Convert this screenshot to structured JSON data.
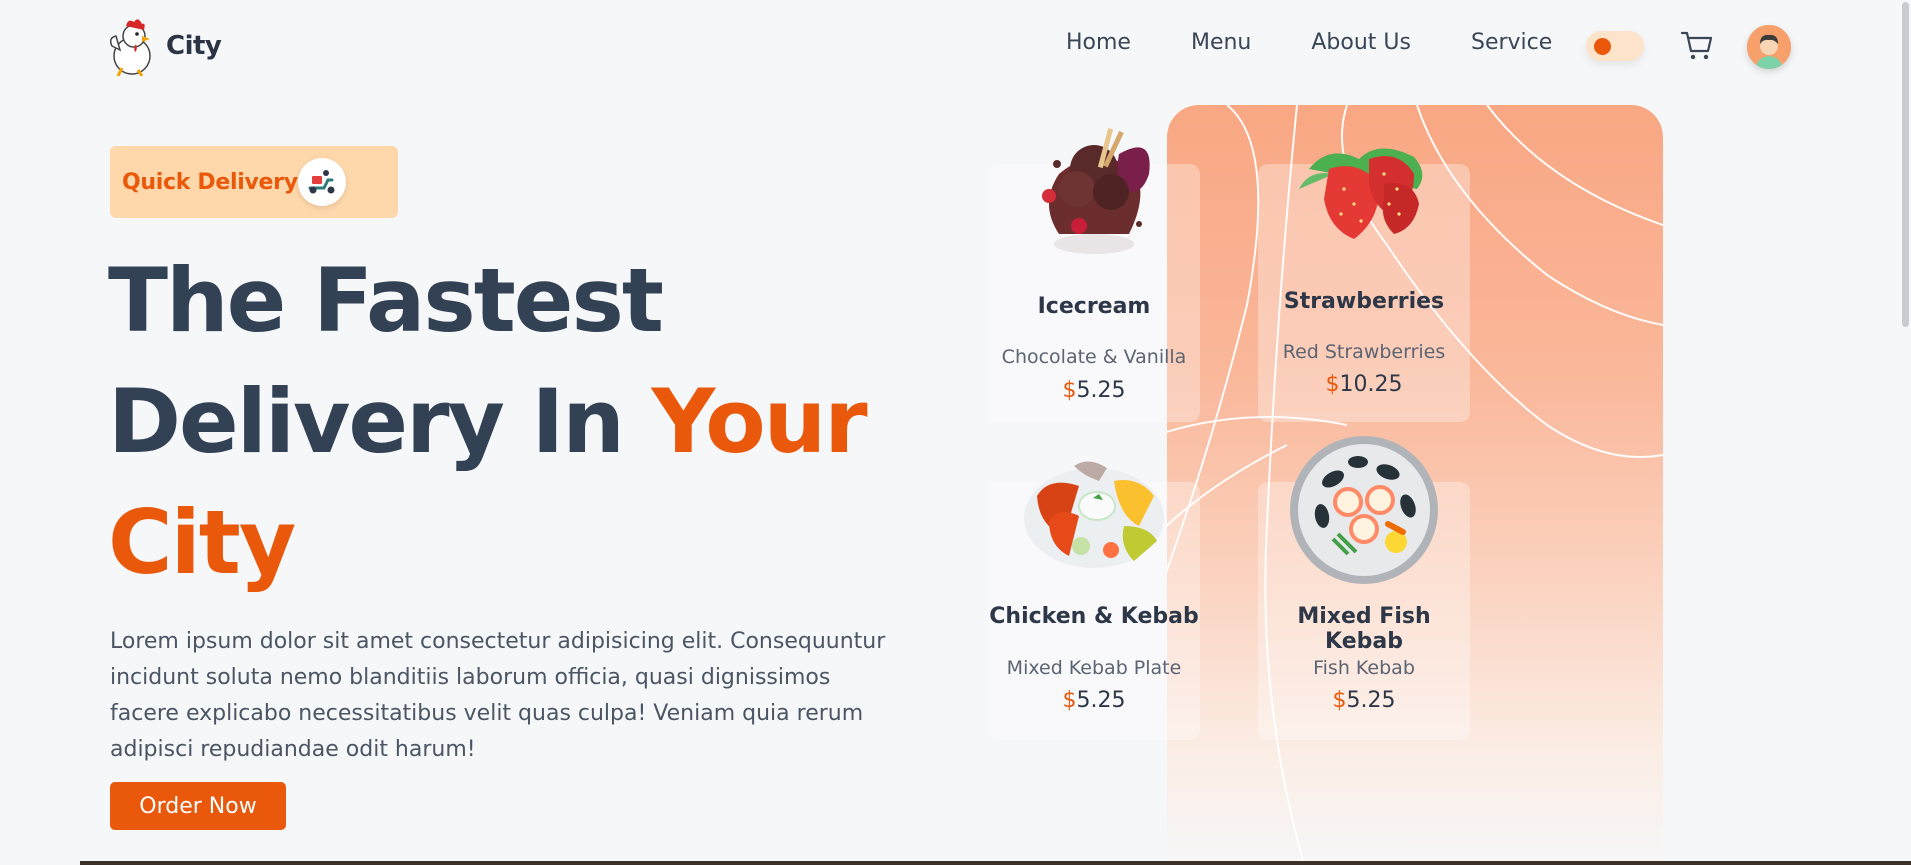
{
  "header": {
    "brand": "City",
    "logo_icon": "chicken-chef-logo-icon",
    "nav": [
      "Home",
      "Menu",
      "About Us",
      "Service"
    ],
    "theme_toggle_icon": "toggle-icon",
    "cart_icon": "cart-icon",
    "avatar_icon": "user-avatar-icon"
  },
  "hero": {
    "badge": {
      "label": "Quick Delivery",
      "icon": "scooter-icon"
    },
    "title_line1": "The Fastest",
    "title_line2_a": "Delivery In",
    "title_line2_b": "Your",
    "title_line3": "City",
    "description": "Lorem ipsum dolor sit amet consectetur adipisicing elit. Consequuntur incidunt soluta nemo blanditiis laborum officia, quasi dignissimos facere explicabo necessitatibus velit quas culpa! Veniam quia rerum adipisci repudiandae odit harum!",
    "cta": "Order Now"
  },
  "items": [
    {
      "name": "Icecream",
      "desc": "Chocolate & Vanilla",
      "currency": "$",
      "price": "5.25",
      "image": "icecream-image"
    },
    {
      "name": "Strawberries",
      "desc": "Red Strawberries",
      "currency": "$",
      "price": "10.25",
      "image": "strawberries-image"
    },
    {
      "name": "Chicken & Kebab",
      "desc": "Mixed Kebab Plate",
      "currency": "$",
      "price": "5.25",
      "image": "kebab-plate-image"
    },
    {
      "name": "Mixed Fish Kebab",
      "desc": "Fish Kebab",
      "currency": "$",
      "price": "5.25",
      "image": "fish-kebab-image"
    }
  ],
  "colors": {
    "accent": "#ea580c",
    "text": "#334155",
    "badge_bg": "#fed7aa",
    "background": "#f6f7f9"
  }
}
